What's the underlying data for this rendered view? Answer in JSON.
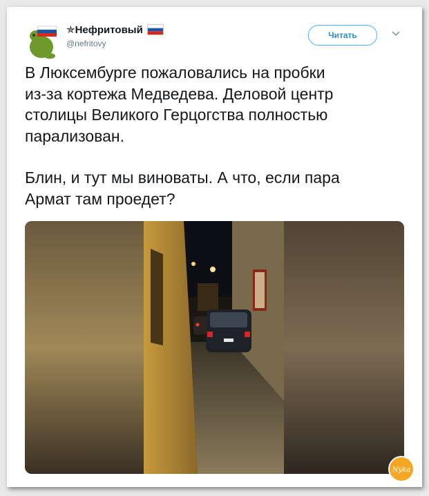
{
  "account": {
    "display_name": "✯Нефритовый",
    "handle": "@nefritovy",
    "flag_icon": "russian-flag-icon",
    "flag_colors": [
      "#ffffff",
      "#1c57a5",
      "#d52b1e"
    ]
  },
  "actions": {
    "follow_label": "Читать",
    "more_icon": "chevron-down-icon"
  },
  "tweet": {
    "paragraph_1": "В Люксембурге пожаловались на пробки\nиз-за кортежа Медведева. Деловой центр\nстолицы Великого Герцогства полностью\nпарализован.",
    "paragraph_2": "Блин, и тут мы виноваты. А что, если пара\nАрмат там проедет?"
  },
  "media": {
    "type": "video-frame",
    "description_icon": "street-photo"
  },
  "watermark": {
    "text": "Nyka",
    "color": "#f5a623"
  },
  "colors": {
    "accent": "#4ab3f4",
    "text": "#14171a",
    "secondary": "#657786"
  }
}
